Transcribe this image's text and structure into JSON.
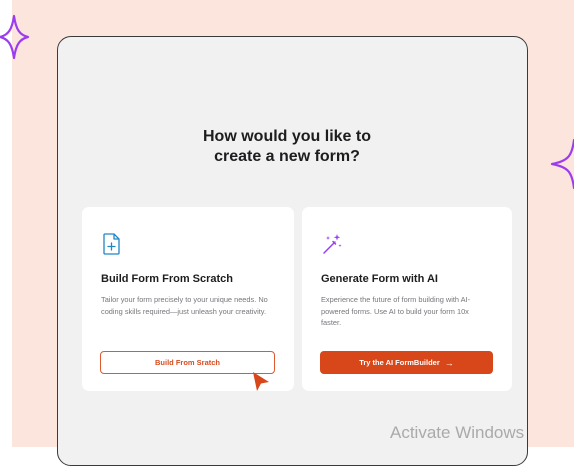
{
  "prompt": {
    "line1": "How would you like to",
    "line2": "create a new form?"
  },
  "cards": [
    {
      "icon": "document-plus-icon",
      "title": "Build Form From Scratch",
      "description": "Tailor your form precisely to your unique needs. No coding skills required—just unleash your creativity.",
      "button_label": "Build From Sratch"
    },
    {
      "icon": "magic-wand-icon",
      "title": "Generate Form with AI",
      "description": "Experience the future of form building with AI-powered forms. Use AI to build your form 10x faster.",
      "button_label": "Try the AI FormBuilder",
      "button_arrow": "→"
    }
  ],
  "watermark": "Activate Windows",
  "colors": {
    "accent": "#d8471a",
    "icon_blue": "#1f86c7",
    "sparkle": "#9b3cf0",
    "background": "#fce5dc"
  }
}
